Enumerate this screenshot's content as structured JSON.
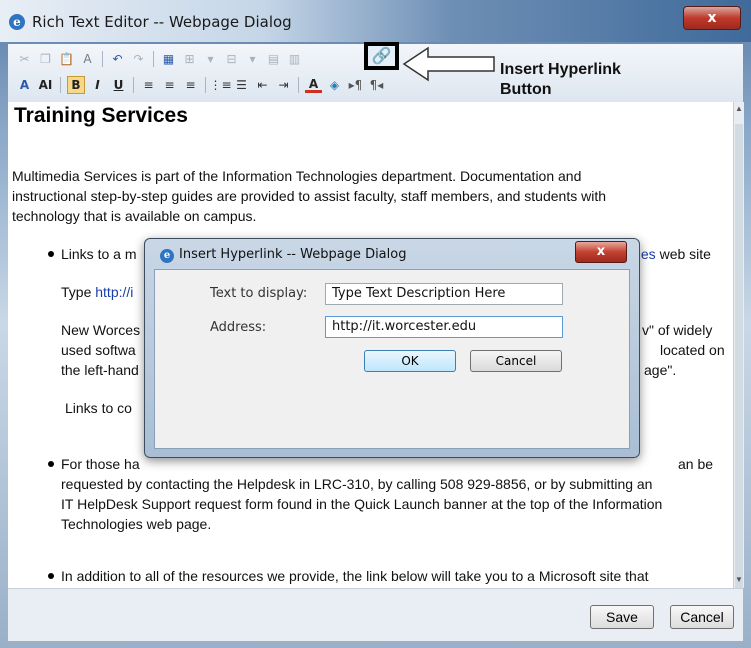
{
  "window": {
    "title": "Rich Text Editor -- Webpage Dialog",
    "close_glyph": "x",
    "ie_glyph": "e"
  },
  "toolbar": {
    "row1": [
      "cut-icon",
      "copy-icon",
      "paste-icon",
      "paste-text-icon",
      "undo-icon",
      "redo-icon",
      "table-icon",
      "insert-row-icon",
      "insert-column-icon",
      "merge-cells-icon",
      "split-cells-icon",
      "hyperlink-icon",
      "image-icon"
    ],
    "row2": [
      "font-icon",
      "font-size-icon",
      "bold-icon",
      "italic-icon",
      "underline-icon",
      "align-left-icon",
      "align-center-icon",
      "align-right-icon",
      "ordered-list-icon",
      "unordered-list-icon",
      "outdent-icon",
      "indent-icon",
      "font-color-icon",
      "highlight-icon",
      "ltr-icon",
      "rtl-icon"
    ],
    "font_label": "A",
    "font_size_label": "AI",
    "bold_label": "B",
    "italic_label": "I",
    "underline_label": "U"
  },
  "annotation": {
    "line1": "Insert Hyperlink",
    "line2": "Button"
  },
  "content": {
    "heading": "Training Services",
    "intro_l1": "Multimedia Services is part of the Information Technologies department.  Documentation and",
    "intro_l2": "instructional step-by-step  guides are provided to assist faculty, staff members, and students with",
    "intro_l3": "technology that is available on campus.",
    "b1_start": "Links to a m",
    "b1_link_end": "gies",
    "b1_end": " web site",
    "type_label": "Type ",
    "type_link": "http://i",
    "nw_l1": "New Worces",
    "nw_l1_end": "v\" of widely",
    "nw_l2": "used softwa",
    "nw_l2_end": "located on",
    "nw_l3": "the left-hand",
    "nw_l3_end": "age\".",
    "links_to_co": "Links to co",
    "b2_l1_start": "For those ha",
    "b2_l1_end": "an be",
    "b2_l2": "requested by contacting the Helpdesk in LRC-310,  by calling 508 929-8856, or by submitting an",
    "b2_l3": "IT HelpDesk Support request form found in the Quick Launch banner at the top of the Information",
    "b2_l4": "Technologies web page.",
    "b3_l1": "In addition to all of the resources we provide, the link below will take you to a Microsoft site that"
  },
  "footer": {
    "save_label": "Save",
    "cancel_label": "Cancel"
  },
  "dialog": {
    "title": "Insert Hyperlink -- Webpage Dialog",
    "close_glyph": "x",
    "text_label": "Text to display:",
    "text_value": "Type Text Description Here",
    "address_label": "Address:",
    "address_value": "http://it.worcester.edu",
    "ok_label": "OK",
    "cancel_label": "Cancel"
  }
}
